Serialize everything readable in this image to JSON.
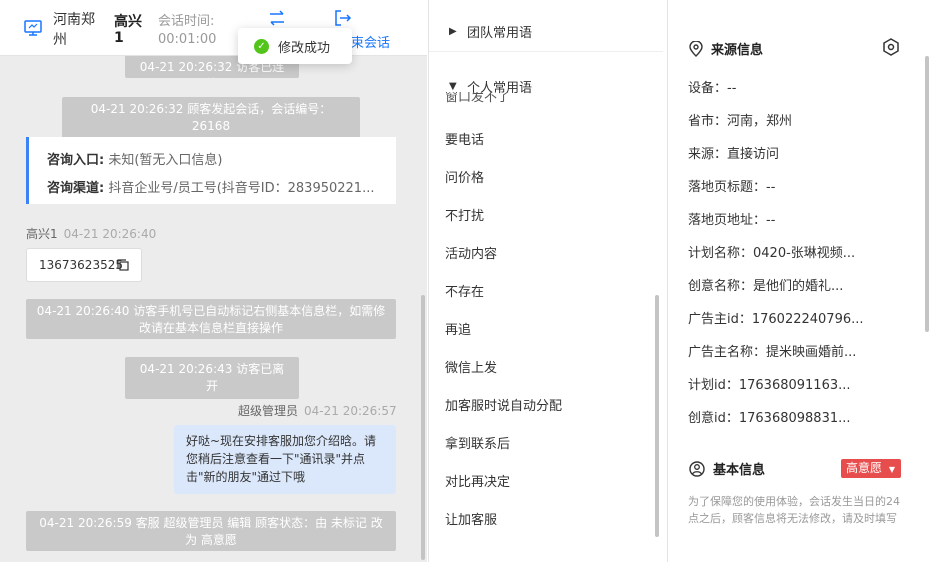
{
  "header": {
    "location": "河南郑州",
    "visitor_name": "高兴1",
    "session_time_label": "会话时间:",
    "session_time_value": "00:01:00",
    "end_session_label": "束会话"
  },
  "toast": {
    "text": "修改成功"
  },
  "chat": {
    "system_top_partial": "04-21 20:26:32 访客已连线",
    "system_session_start": "04-21 20:26:32 顾客发起会话，会话编号：26168",
    "source_card": {
      "entry_label": "咨询入口:",
      "entry_value": "未知(暂无入口信息)",
      "channel_label": "咨询渠道:",
      "channel_value": "抖音企业号/员工号(抖音号ID：283950221..."
    },
    "visitor_msg": {
      "name": "高兴1",
      "time": "04-21 20:26:40",
      "text": "13673623525"
    },
    "system_phone_marked": "04-21 20:26:40 访客手机号已自动标记右侧基本信息栏，如需修改请在基本信息栏直接操作",
    "system_left": "04-21 20:26:43 访客已离开",
    "agent_msg": {
      "name": "超级管理员",
      "time": "04-21 20:26:57",
      "text": "好哒~现在安排客服加您介绍晗。请您稍后注意查看一下\"通讯录\"并点击\"新的朋友\"通过下哦"
    },
    "system_status_change": "04-21 20:26:59 客服 超级管理员 编辑 顾客状态：由 未标记 改为 高意愿"
  },
  "phrases": {
    "team_group": "团队常用语",
    "personal_group": "个人常用语",
    "partial_item": "窗口发不了",
    "items": [
      "要电话",
      "问价格",
      "不打扰",
      "活动内容",
      "不存在",
      "再追",
      "微信上发",
      "加客服时说自动分配",
      "拿到联系后",
      "对比再决定",
      "让加客服"
    ]
  },
  "info": {
    "source_title": "来源信息",
    "source_fields": [
      "设备：--",
      "省市：河南，郑州",
      "来源：直接访问",
      "落地页标题：--",
      "落地页地址：--",
      "计划名称：0420-张琳视频...",
      "创意名称：是他们的婚礼...",
      "广告主id：176022240796...",
      "广告主名称：提米映画婚前...",
      "计划id：176368091163...",
      "创意id：176368098831..."
    ],
    "basic_title": "基本信息",
    "intent_label": "高意愿",
    "note": "为了保障您的使用体验，会话发生当日的24点之后，顾客信息将无法修改，请及时填写"
  },
  "colors": {
    "accent": "#1677ff",
    "intent_red": "#e84d4d",
    "agent_bubble": "#dbe8fb",
    "success": "#52c41a"
  }
}
